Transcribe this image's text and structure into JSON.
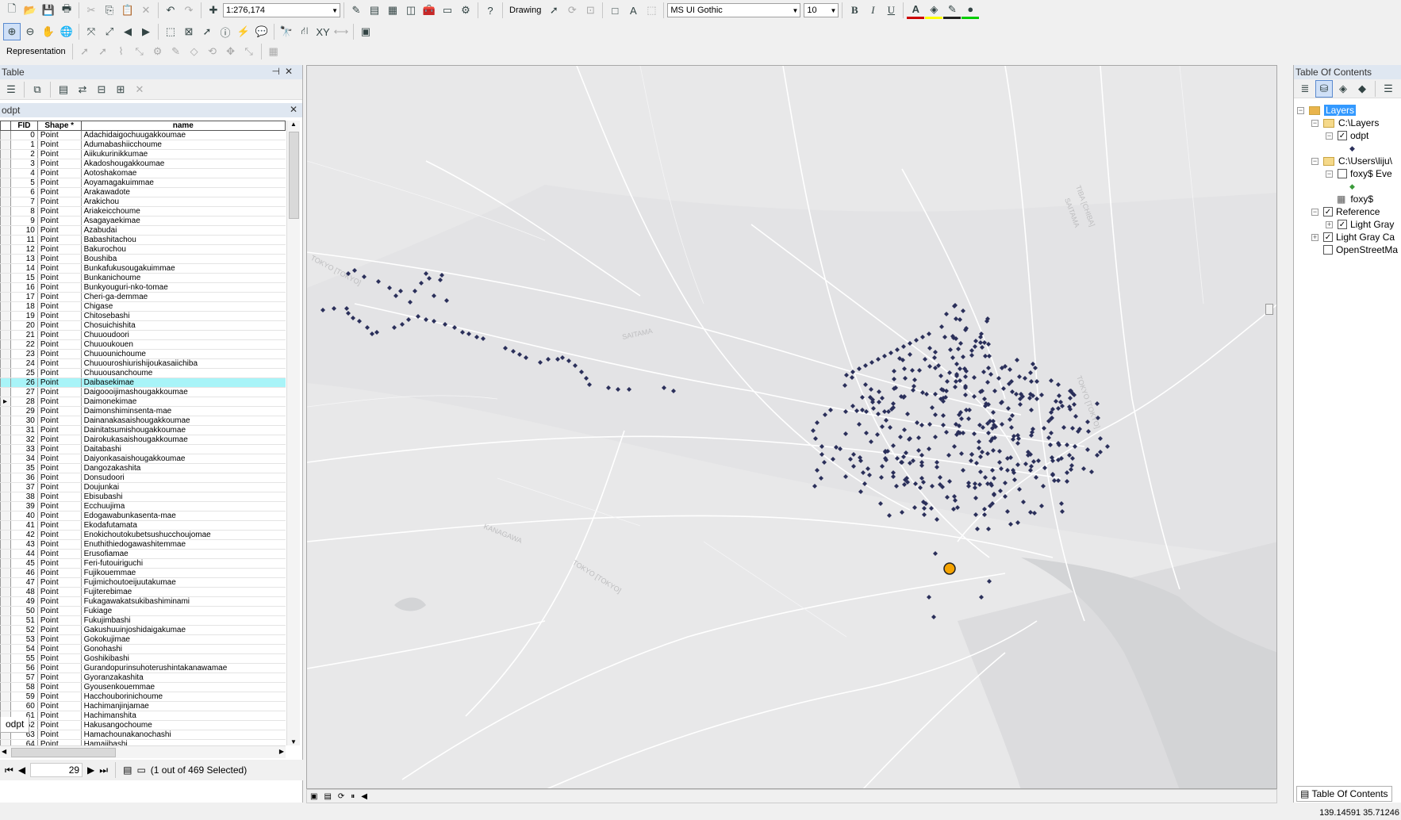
{
  "toolbar": {
    "scale": "1:276,174",
    "drawing_label": "Drawing",
    "font_name": "MS UI Gothic",
    "font_size": "10",
    "bold": "B",
    "italic": "I",
    "underline": "U",
    "representation_label": "Representation",
    "font_color_glyph": "A"
  },
  "table_panel": {
    "title": "Table",
    "tab_name": "odpt",
    "columns": [
      "FID",
      "Shape *",
      "name"
    ],
    "rows": [
      [
        0,
        "Point",
        "Adachidaigochuugakkoumae"
      ],
      [
        1,
        "Point",
        "Adumabashiicchoume"
      ],
      [
        2,
        "Point",
        "Aiikukurinikkumae"
      ],
      [
        3,
        "Point",
        "Akadoshougakkoumae"
      ],
      [
        4,
        "Point",
        "Aotoshakomae"
      ],
      [
        5,
        "Point",
        "Aoyamagakuimmae"
      ],
      [
        6,
        "Point",
        "Arakawadote"
      ],
      [
        7,
        "Point",
        "Arakichou"
      ],
      [
        8,
        "Point",
        "Ariakeicchoume"
      ],
      [
        9,
        "Point",
        "Asagayaekimae"
      ],
      [
        10,
        "Point",
        "Azabudai"
      ],
      [
        11,
        "Point",
        "Babashitachou"
      ],
      [
        12,
        "Point",
        "Bakurochou"
      ],
      [
        13,
        "Point",
        "Boushiba"
      ],
      [
        14,
        "Point",
        "Bunkafukusougakuimmae"
      ],
      [
        15,
        "Point",
        "Bunkanichoume"
      ],
      [
        16,
        "Point",
        "Bunkyouguri-nko-tomae"
      ],
      [
        17,
        "Point",
        "Cheri-ga-demmae"
      ],
      [
        18,
        "Point",
        "Chigase"
      ],
      [
        19,
        "Point",
        "Chitosebashi"
      ],
      [
        20,
        "Point",
        "Chosuichishita"
      ],
      [
        21,
        "Point",
        "Chuuoudoori"
      ],
      [
        22,
        "Point",
        "Chuuoukouen"
      ],
      [
        23,
        "Point",
        "Chuuounichoume"
      ],
      [
        24,
        "Point",
        "Chuuouroshiurishijoukasaiichiba"
      ],
      [
        25,
        "Point",
        "Chuuousanchoume"
      ],
      [
        26,
        "Point",
        "Daibasekimae"
      ],
      [
        27,
        "Point",
        "Daigoooijimashougakkoumae"
      ],
      [
        28,
        "Point",
        "Daimonekimae"
      ],
      [
        29,
        "Point",
        "Daimonshiminsenta-mae"
      ],
      [
        30,
        "Point",
        "Dainanakasaishougakkoumae"
      ],
      [
        31,
        "Point",
        "Dainitatsumishougakkoumae"
      ],
      [
        32,
        "Point",
        "Dairokukasaishougakkoumae"
      ],
      [
        33,
        "Point",
        "Daitabashi"
      ],
      [
        34,
        "Point",
        "Daiyonkasaishougakkoumae"
      ],
      [
        35,
        "Point",
        "Dangozakashita"
      ],
      [
        36,
        "Point",
        "Donsudoori"
      ],
      [
        37,
        "Point",
        "Doujunkai"
      ],
      [
        38,
        "Point",
        "Ebisubashi"
      ],
      [
        39,
        "Point",
        "Ecchuujima"
      ],
      [
        40,
        "Point",
        "Edogawabunkasenta-mae"
      ],
      [
        41,
        "Point",
        "Ekodafutamata"
      ],
      [
        42,
        "Point",
        "Enokichoutokubetsushucchoujomae"
      ],
      [
        43,
        "Point",
        "Enuthithiedogawashitemmae"
      ],
      [
        44,
        "Point",
        "Erusofiamae"
      ],
      [
        45,
        "Point",
        "Feri-futouiriguchi"
      ],
      [
        46,
        "Point",
        "Fujikouemmae"
      ],
      [
        47,
        "Point",
        "Fujimichoutoeijuutakumae"
      ],
      [
        48,
        "Point",
        "Fujiterebimae"
      ],
      [
        49,
        "Point",
        "Fukagawakatsukibashiminami"
      ],
      [
        50,
        "Point",
        "Fukiage"
      ],
      [
        51,
        "Point",
        "Fukujimbashi"
      ],
      [
        52,
        "Point",
        "Gakushuuinjoshidaigakumae"
      ],
      [
        53,
        "Point",
        "Gokokujimae"
      ],
      [
        54,
        "Point",
        "Gonohashi"
      ],
      [
        55,
        "Point",
        "Goshikibashi"
      ],
      [
        56,
        "Point",
        "Gurandopurinsuhoterushintakanawamae"
      ],
      [
        57,
        "Point",
        "Gyoranzakashita"
      ],
      [
        58,
        "Point",
        "Gyousenkouemmae"
      ],
      [
        59,
        "Point",
        "Hacchouborinichoume"
      ],
      [
        60,
        "Point",
        "Hachimanjinjamae"
      ],
      [
        61,
        "Point",
        "Hachimanshita"
      ],
      [
        62,
        "Point",
        "Hakusangochoume"
      ],
      [
        63,
        "Point",
        "Hamachounakanochashi"
      ],
      [
        64,
        "Point",
        "Hamajibashi"
      ]
    ],
    "highlighted_fid": 26,
    "current_fid": 28,
    "record_number": "29",
    "selection_status": "(1 out of 469 Selected)"
  },
  "toc": {
    "title": "Table Of Contents",
    "items": {
      "root": "Layers",
      "group1": "C:\\Layers",
      "layer1": "odpt",
      "group2": "C:\\Users\\liju\\",
      "layer2": "foxy$ Eve",
      "table1": "foxy$",
      "group3": "Reference",
      "layer3": "Light Gray",
      "layer4": "Light Gray Ca",
      "layer5": "OpenStreetMa"
    },
    "tab_label": "Table Of Contents"
  },
  "map": {
    "labels": [
      "TOKYO [TOKYO]",
      "SAITAMA",
      "KANAGAWA",
      "TOKYO [TOKYO]",
      "TOKYO [TOKYO]",
      "TIBA [CHIBA]",
      "SAITAMA"
    ],
    "colors": {
      "point": "#2a2f5a",
      "selected": "#f5a300",
      "land": "#e8e8e9",
      "water": "#d3d4d6",
      "road": "#ffffff",
      "dark_region": "#dcdcde"
    }
  },
  "status": {
    "coordinates": "139.14591  35.71246"
  }
}
